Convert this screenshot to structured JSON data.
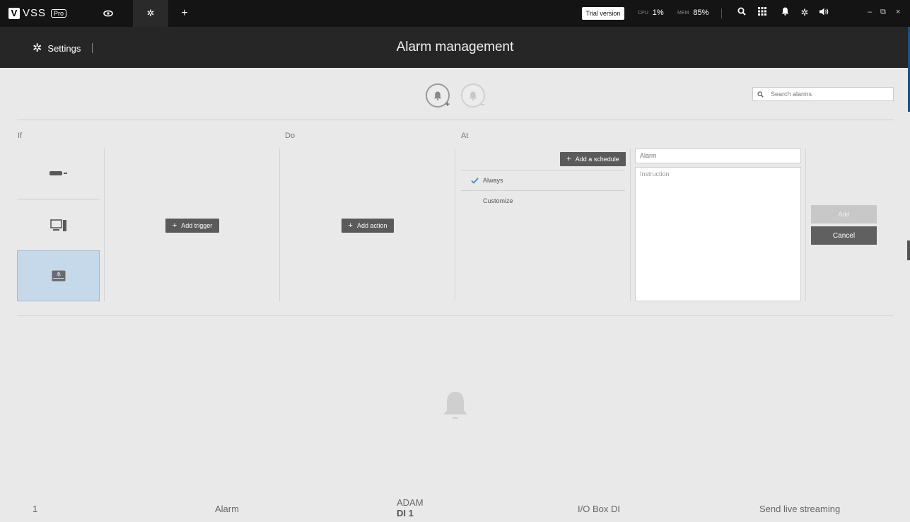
{
  "topbar": {
    "logo_letter": "V",
    "logo_text": "VSS",
    "logo_badge": "Pro",
    "tabs": [
      "eye-icon",
      "gear-icon",
      "plus-icon"
    ],
    "trial": "Trial version",
    "cpu_label": "CPU",
    "cpu_value": "1%",
    "mem_label": "MEM",
    "mem_value": "85%",
    "icons": [
      "search-icon",
      "grid-icon",
      "bell-icon",
      "gear-icon",
      "speaker-icon"
    ],
    "window": {
      "minimize": "–",
      "restore": "⧉",
      "close": "×"
    }
  },
  "header": {
    "settings_label": "Settings",
    "title": "Alarm management"
  },
  "toolbar": {
    "search_placeholder": "Search alarms"
  },
  "columns": {
    "if": "If",
    "do": "Do",
    "at": "At"
  },
  "buttons": {
    "add_trigger": "Add trigger",
    "add_action": "Add action",
    "add_schedule": "Add a schedule",
    "add": "Add",
    "cancel": "Cancel"
  },
  "schedule": {
    "always": "Always",
    "customize": "Customize"
  },
  "form": {
    "name_value": "Alarm",
    "instruction_placeholder": "Instruction"
  },
  "row": {
    "index": "1",
    "name": "Alarm",
    "source_top": "ADAM",
    "source_bottom": "DI 1",
    "type": "I/O Box DI",
    "action": "Send live streaming"
  },
  "colors": {
    "accent": "#1d4f8b",
    "selected": "#c6d9ea",
    "check": "#3d8ad6"
  }
}
